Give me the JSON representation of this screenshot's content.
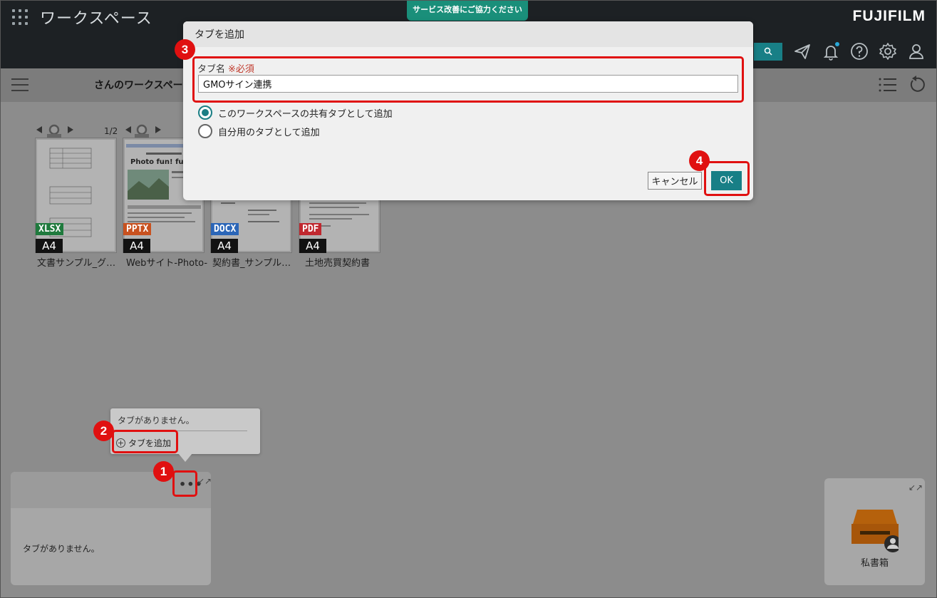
{
  "header": {
    "app_title": "ワークスペース",
    "survey_banner": "サービス改善にご協力ください",
    "logo": "FUJIFILM",
    "icons": [
      "apps-grid-icon",
      "search-icon",
      "send-icon",
      "bell-icon",
      "help-icon",
      "gear-icon",
      "user-icon"
    ]
  },
  "toolbar": {
    "workspace_name": "さんのワークスペース"
  },
  "documents": {
    "pager": "1/2",
    "items": [
      {
        "name": "文書サンプル_グ…",
        "type": "XLSX",
        "type_color": "#1f7a3d",
        "size": "A4"
      },
      {
        "name": "Webサイト-Photo-",
        "type": "PPTX",
        "type_color": "#c8511f",
        "size": "A4"
      },
      {
        "name": "契約書_サンプル…",
        "type": "DOCX",
        "type_color": "#2b66b8",
        "size": "A4"
      },
      {
        "name": "土地売買契約書",
        "type": "PDF",
        "type_color": "#c0282f",
        "size": "A4"
      }
    ]
  },
  "dialog": {
    "title": "タブを追加",
    "field_label": "タブ名",
    "required_mark": "※必須",
    "field_value": "GMOサイン連携",
    "options": [
      {
        "label": "このワークスペースの共有タブとして追加",
        "checked": true
      },
      {
        "label": "自分用のタブとして追加",
        "checked": false
      }
    ],
    "cancel_label": "キャンセル",
    "ok_label": "OK"
  },
  "popover": {
    "empty_text": "タブがありません。",
    "add_label": "タブを追加"
  },
  "panel_left": {
    "empty_text": "タブがありません。"
  },
  "panel_right": {
    "label": "私書箱"
  },
  "callouts": [
    "1",
    "2",
    "3",
    "4"
  ],
  "colors": {
    "accent": "#187f86",
    "callout": "#e01010",
    "header_bg": "#1d2124",
    "survey_bg": "#1a8f7a"
  }
}
